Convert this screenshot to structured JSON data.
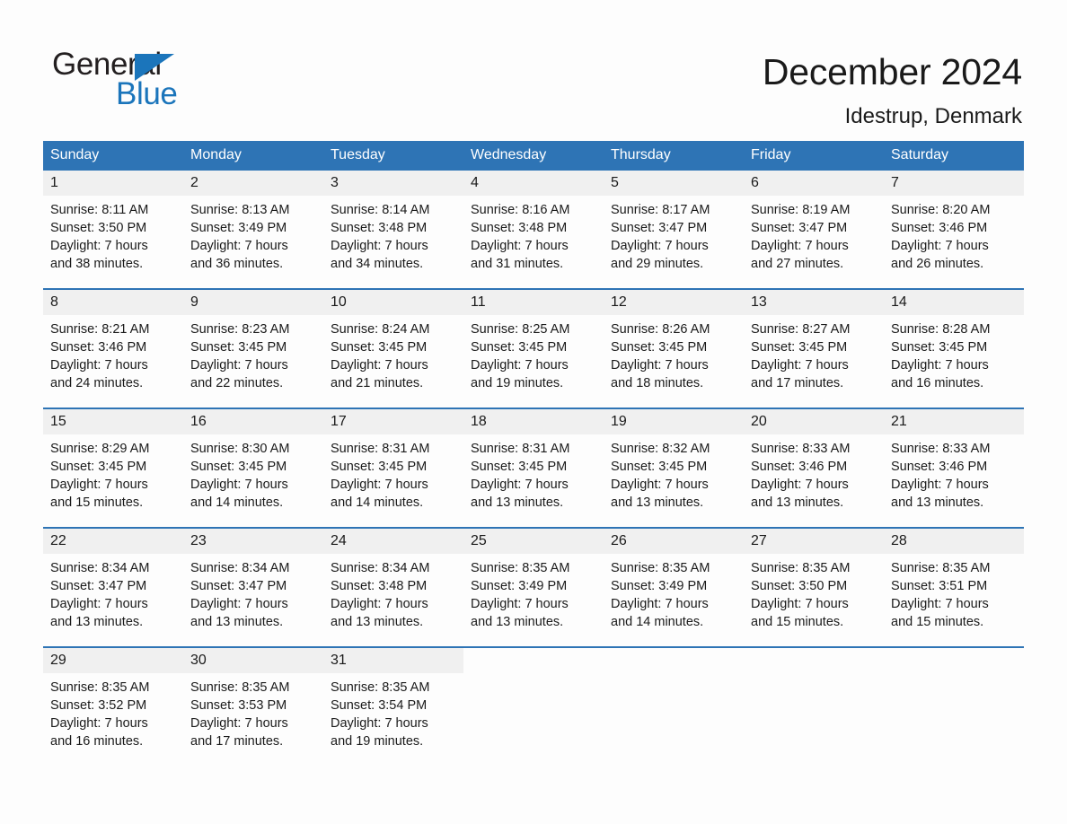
{
  "brand": {
    "name_part1": "General",
    "name_part2": "Blue",
    "accent_color": "#1b75bb",
    "triangle_icon": "triangle-icon"
  },
  "header": {
    "title": "December 2024",
    "location": "Idestrup, Denmark"
  },
  "calendar": {
    "header_bg": "#2e74b5",
    "daynum_bg": "#f0f0f0",
    "weekdays": [
      "Sunday",
      "Monday",
      "Tuesday",
      "Wednesday",
      "Thursday",
      "Friday",
      "Saturday"
    ],
    "weeks": [
      [
        {
          "day": "1",
          "sunrise": "Sunrise: 8:11 AM",
          "sunset": "Sunset: 3:50 PM",
          "daylight_line1": "Daylight: 7 hours",
          "daylight_line2": "and 38 minutes."
        },
        {
          "day": "2",
          "sunrise": "Sunrise: 8:13 AM",
          "sunset": "Sunset: 3:49 PM",
          "daylight_line1": "Daylight: 7 hours",
          "daylight_line2": "and 36 minutes."
        },
        {
          "day": "3",
          "sunrise": "Sunrise: 8:14 AM",
          "sunset": "Sunset: 3:48 PM",
          "daylight_line1": "Daylight: 7 hours",
          "daylight_line2": "and 34 minutes."
        },
        {
          "day": "4",
          "sunrise": "Sunrise: 8:16 AM",
          "sunset": "Sunset: 3:48 PM",
          "daylight_line1": "Daylight: 7 hours",
          "daylight_line2": "and 31 minutes."
        },
        {
          "day": "5",
          "sunrise": "Sunrise: 8:17 AM",
          "sunset": "Sunset: 3:47 PM",
          "daylight_line1": "Daylight: 7 hours",
          "daylight_line2": "and 29 minutes."
        },
        {
          "day": "6",
          "sunrise": "Sunrise: 8:19 AM",
          "sunset": "Sunset: 3:47 PM",
          "daylight_line1": "Daylight: 7 hours",
          "daylight_line2": "and 27 minutes."
        },
        {
          "day": "7",
          "sunrise": "Sunrise: 8:20 AM",
          "sunset": "Sunset: 3:46 PM",
          "daylight_line1": "Daylight: 7 hours",
          "daylight_line2": "and 26 minutes."
        }
      ],
      [
        {
          "day": "8",
          "sunrise": "Sunrise: 8:21 AM",
          "sunset": "Sunset: 3:46 PM",
          "daylight_line1": "Daylight: 7 hours",
          "daylight_line2": "and 24 minutes."
        },
        {
          "day": "9",
          "sunrise": "Sunrise: 8:23 AM",
          "sunset": "Sunset: 3:45 PM",
          "daylight_line1": "Daylight: 7 hours",
          "daylight_line2": "and 22 minutes."
        },
        {
          "day": "10",
          "sunrise": "Sunrise: 8:24 AM",
          "sunset": "Sunset: 3:45 PM",
          "daylight_line1": "Daylight: 7 hours",
          "daylight_line2": "and 21 minutes."
        },
        {
          "day": "11",
          "sunrise": "Sunrise: 8:25 AM",
          "sunset": "Sunset: 3:45 PM",
          "daylight_line1": "Daylight: 7 hours",
          "daylight_line2": "and 19 minutes."
        },
        {
          "day": "12",
          "sunrise": "Sunrise: 8:26 AM",
          "sunset": "Sunset: 3:45 PM",
          "daylight_line1": "Daylight: 7 hours",
          "daylight_line2": "and 18 minutes."
        },
        {
          "day": "13",
          "sunrise": "Sunrise: 8:27 AM",
          "sunset": "Sunset: 3:45 PM",
          "daylight_line1": "Daylight: 7 hours",
          "daylight_line2": "and 17 minutes."
        },
        {
          "day": "14",
          "sunrise": "Sunrise: 8:28 AM",
          "sunset": "Sunset: 3:45 PM",
          "daylight_line1": "Daylight: 7 hours",
          "daylight_line2": "and 16 minutes."
        }
      ],
      [
        {
          "day": "15",
          "sunrise": "Sunrise: 8:29 AM",
          "sunset": "Sunset: 3:45 PM",
          "daylight_line1": "Daylight: 7 hours",
          "daylight_line2": "and 15 minutes."
        },
        {
          "day": "16",
          "sunrise": "Sunrise: 8:30 AM",
          "sunset": "Sunset: 3:45 PM",
          "daylight_line1": "Daylight: 7 hours",
          "daylight_line2": "and 14 minutes."
        },
        {
          "day": "17",
          "sunrise": "Sunrise: 8:31 AM",
          "sunset": "Sunset: 3:45 PM",
          "daylight_line1": "Daylight: 7 hours",
          "daylight_line2": "and 14 minutes."
        },
        {
          "day": "18",
          "sunrise": "Sunrise: 8:31 AM",
          "sunset": "Sunset: 3:45 PM",
          "daylight_line1": "Daylight: 7 hours",
          "daylight_line2": "and 13 minutes."
        },
        {
          "day": "19",
          "sunrise": "Sunrise: 8:32 AM",
          "sunset": "Sunset: 3:45 PM",
          "daylight_line1": "Daylight: 7 hours",
          "daylight_line2": "and 13 minutes."
        },
        {
          "day": "20",
          "sunrise": "Sunrise: 8:33 AM",
          "sunset": "Sunset: 3:46 PM",
          "daylight_line1": "Daylight: 7 hours",
          "daylight_line2": "and 13 minutes."
        },
        {
          "day": "21",
          "sunrise": "Sunrise: 8:33 AM",
          "sunset": "Sunset: 3:46 PM",
          "daylight_line1": "Daylight: 7 hours",
          "daylight_line2": "and 13 minutes."
        }
      ],
      [
        {
          "day": "22",
          "sunrise": "Sunrise: 8:34 AM",
          "sunset": "Sunset: 3:47 PM",
          "daylight_line1": "Daylight: 7 hours",
          "daylight_line2": "and 13 minutes."
        },
        {
          "day": "23",
          "sunrise": "Sunrise: 8:34 AM",
          "sunset": "Sunset: 3:47 PM",
          "daylight_line1": "Daylight: 7 hours",
          "daylight_line2": "and 13 minutes."
        },
        {
          "day": "24",
          "sunrise": "Sunrise: 8:34 AM",
          "sunset": "Sunset: 3:48 PM",
          "daylight_line1": "Daylight: 7 hours",
          "daylight_line2": "and 13 minutes."
        },
        {
          "day": "25",
          "sunrise": "Sunrise: 8:35 AM",
          "sunset": "Sunset: 3:49 PM",
          "daylight_line1": "Daylight: 7 hours",
          "daylight_line2": "and 13 minutes."
        },
        {
          "day": "26",
          "sunrise": "Sunrise: 8:35 AM",
          "sunset": "Sunset: 3:49 PM",
          "daylight_line1": "Daylight: 7 hours",
          "daylight_line2": "and 14 minutes."
        },
        {
          "day": "27",
          "sunrise": "Sunrise: 8:35 AM",
          "sunset": "Sunset: 3:50 PM",
          "daylight_line1": "Daylight: 7 hours",
          "daylight_line2": "and 15 minutes."
        },
        {
          "day": "28",
          "sunrise": "Sunrise: 8:35 AM",
          "sunset": "Sunset: 3:51 PM",
          "daylight_line1": "Daylight: 7 hours",
          "daylight_line2": "and 15 minutes."
        }
      ],
      [
        {
          "day": "29",
          "sunrise": "Sunrise: 8:35 AM",
          "sunset": "Sunset: 3:52 PM",
          "daylight_line1": "Daylight: 7 hours",
          "daylight_line2": "and 16 minutes."
        },
        {
          "day": "30",
          "sunrise": "Sunrise: 8:35 AM",
          "sunset": "Sunset: 3:53 PM",
          "daylight_line1": "Daylight: 7 hours",
          "daylight_line2": "and 17 minutes."
        },
        {
          "day": "31",
          "sunrise": "Sunrise: 8:35 AM",
          "sunset": "Sunset: 3:54 PM",
          "daylight_line1": "Daylight: 7 hours",
          "daylight_line2": "and 19 minutes."
        },
        {
          "day": "",
          "sunrise": "",
          "sunset": "",
          "daylight_line1": "",
          "daylight_line2": ""
        },
        {
          "day": "",
          "sunrise": "",
          "sunset": "",
          "daylight_line1": "",
          "daylight_line2": ""
        },
        {
          "day": "",
          "sunrise": "",
          "sunset": "",
          "daylight_line1": "",
          "daylight_line2": ""
        },
        {
          "day": "",
          "sunrise": "",
          "sunset": "",
          "daylight_line1": "",
          "daylight_line2": ""
        }
      ]
    ]
  }
}
